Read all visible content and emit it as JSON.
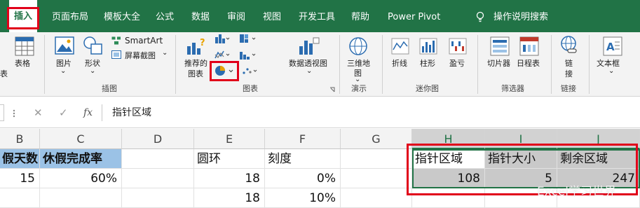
{
  "tabs": [
    {
      "label": "插入",
      "active": true
    },
    {
      "label": "页面布局"
    },
    {
      "label": "模板大全"
    },
    {
      "label": "公式"
    },
    {
      "label": "数据"
    },
    {
      "label": "审阅"
    },
    {
      "label": "视图"
    },
    {
      "label": "开发工具"
    },
    {
      "label": "帮助"
    },
    {
      "label": "Power Pivot"
    },
    {
      "label": "操作说明搜索"
    }
  ],
  "ribbon": {
    "table_partial": "表",
    "table": "表格",
    "picture_l1": "图片",
    "picture_l2": "⌄",
    "shapes_l1": "形状",
    "shapes_l2": "⌄",
    "smartart": "SmartArt",
    "screenshot": "屏幕截图",
    "screenshot_caret": "⌄",
    "recommended_l1": "推荐的",
    "recommended_l2": "图表",
    "pivotchart": "数据透视图",
    "pivotchart_caret": "⌄",
    "map3d_l1": "三维地",
    "map3d_l2": "图",
    "map3d_l3": "⌄",
    "line": "折线",
    "column": "柱形",
    "winloss": "盈亏",
    "slicer": "切片器",
    "timeline": "日程表",
    "link_l1": "链",
    "link_l2": "接",
    "textbox": "文本框",
    "textbox_caret": "⌄",
    "groups": {
      "illustrations": "插图",
      "charts": "图表",
      "tours": "演示",
      "sparklines": "迷你图",
      "filters": "筛选器",
      "links": "链接"
    }
  },
  "formula": {
    "cancel": "✕",
    "enter": "✓",
    "fx": "fx",
    "content": "指针区域"
  },
  "columns": [
    "B",
    "C",
    "D",
    "E",
    "F",
    "G",
    "H",
    "I",
    "J"
  ],
  "row1": {
    "b": "假天数",
    "c": "休假完成率",
    "e": "圆环",
    "f": "刻度",
    "h": "指针区域",
    "i": "指针大小",
    "j": "剩余区域"
  },
  "row2": {
    "b": "15",
    "c": "60%",
    "e": "18",
    "f": "0%",
    "h": "108",
    "i": "5",
    "j": "247"
  },
  "row3": {
    "e": "18",
    "f": "10%"
  },
  "watermark": "Excel学习世界",
  "colors": {
    "ribbon_green": "#217346",
    "highlight_red": "#e1001a",
    "header_blue": "#9bc2e6",
    "selection_gray": "#c9c9c9"
  }
}
